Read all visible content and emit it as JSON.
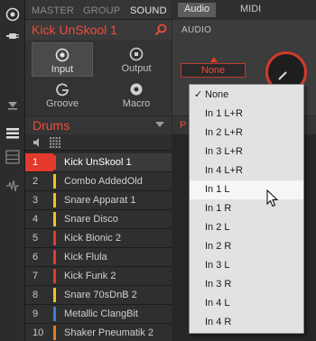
{
  "header": {
    "tabs": [
      "MASTER",
      "GROUP",
      "SOUND"
    ],
    "active_tab": "SOUND",
    "sound_name": "Kick UnSkool 1"
  },
  "pages": [
    {
      "label": "Input",
      "icon": "input-icon",
      "selected": true
    },
    {
      "label": "Output",
      "icon": "output-icon",
      "selected": false
    },
    {
      "label": "Groove",
      "icon": "groove-icon",
      "selected": false
    },
    {
      "label": "Macro",
      "icon": "macro-icon",
      "selected": false
    }
  ],
  "right_panel": {
    "tabs": [
      "Audio",
      "MIDI"
    ],
    "active_tab": "Audio",
    "section_label": "AUDIO",
    "source_value": "None"
  },
  "group": {
    "name": "Drums",
    "sounds": [
      {
        "num": "1",
        "name": "Kick UnSkool 1",
        "color": "#e33a2d",
        "selected": true
      },
      {
        "num": "2",
        "name": "Combo AddedOld",
        "color": "#f0c419",
        "selected": false
      },
      {
        "num": "3",
        "name": "Snare Apparat 1",
        "color": "#f0c419",
        "selected": false
      },
      {
        "num": "4",
        "name": "Snare Disco",
        "color": "#f0c419",
        "selected": false
      },
      {
        "num": "5",
        "name": "Kick Bionic 2",
        "color": "#e33a2d",
        "selected": false
      },
      {
        "num": "6",
        "name": "Kick Flula",
        "color": "#e33a2d",
        "selected": false
      },
      {
        "num": "7",
        "name": "Kick Funk 2",
        "color": "#e33a2d",
        "selected": false
      },
      {
        "num": "8",
        "name": "Snare 70sDnB 2",
        "color": "#f0c419",
        "selected": false
      },
      {
        "num": "9",
        "name": "Metallic ClangBit",
        "color": "#3a7fd6",
        "selected": false
      },
      {
        "num": "10",
        "name": "Shaker Pneumatik 2",
        "color": "#e87a1e",
        "selected": false
      }
    ]
  },
  "pattern_col": {
    "label": "P"
  },
  "menu": {
    "items": [
      {
        "label": "None",
        "checked": true,
        "highlighted": false
      },
      {
        "label": "In 1 L+R",
        "checked": false,
        "highlighted": false
      },
      {
        "label": "In 2 L+R",
        "checked": false,
        "highlighted": false
      },
      {
        "label": "In 3 L+R",
        "checked": false,
        "highlighted": false
      },
      {
        "label": "In 4 L+R",
        "checked": false,
        "highlighted": false
      },
      {
        "label": "In 1 L",
        "checked": false,
        "highlighted": true
      },
      {
        "label": "In 1 R",
        "checked": false,
        "highlighted": false
      },
      {
        "label": "In 2 L",
        "checked": false,
        "highlighted": false
      },
      {
        "label": "In 2 R",
        "checked": false,
        "highlighted": false
      },
      {
        "label": "In 3 L",
        "checked": false,
        "highlighted": false
      },
      {
        "label": "In 3 R",
        "checked": false,
        "highlighted": false
      },
      {
        "label": "In 4 L",
        "checked": false,
        "highlighted": false
      },
      {
        "label": "In 4 R",
        "checked": false,
        "highlighted": false
      }
    ]
  },
  "colors": {
    "accent": "#e33a2d",
    "accent_text": "#ec4c3c"
  }
}
